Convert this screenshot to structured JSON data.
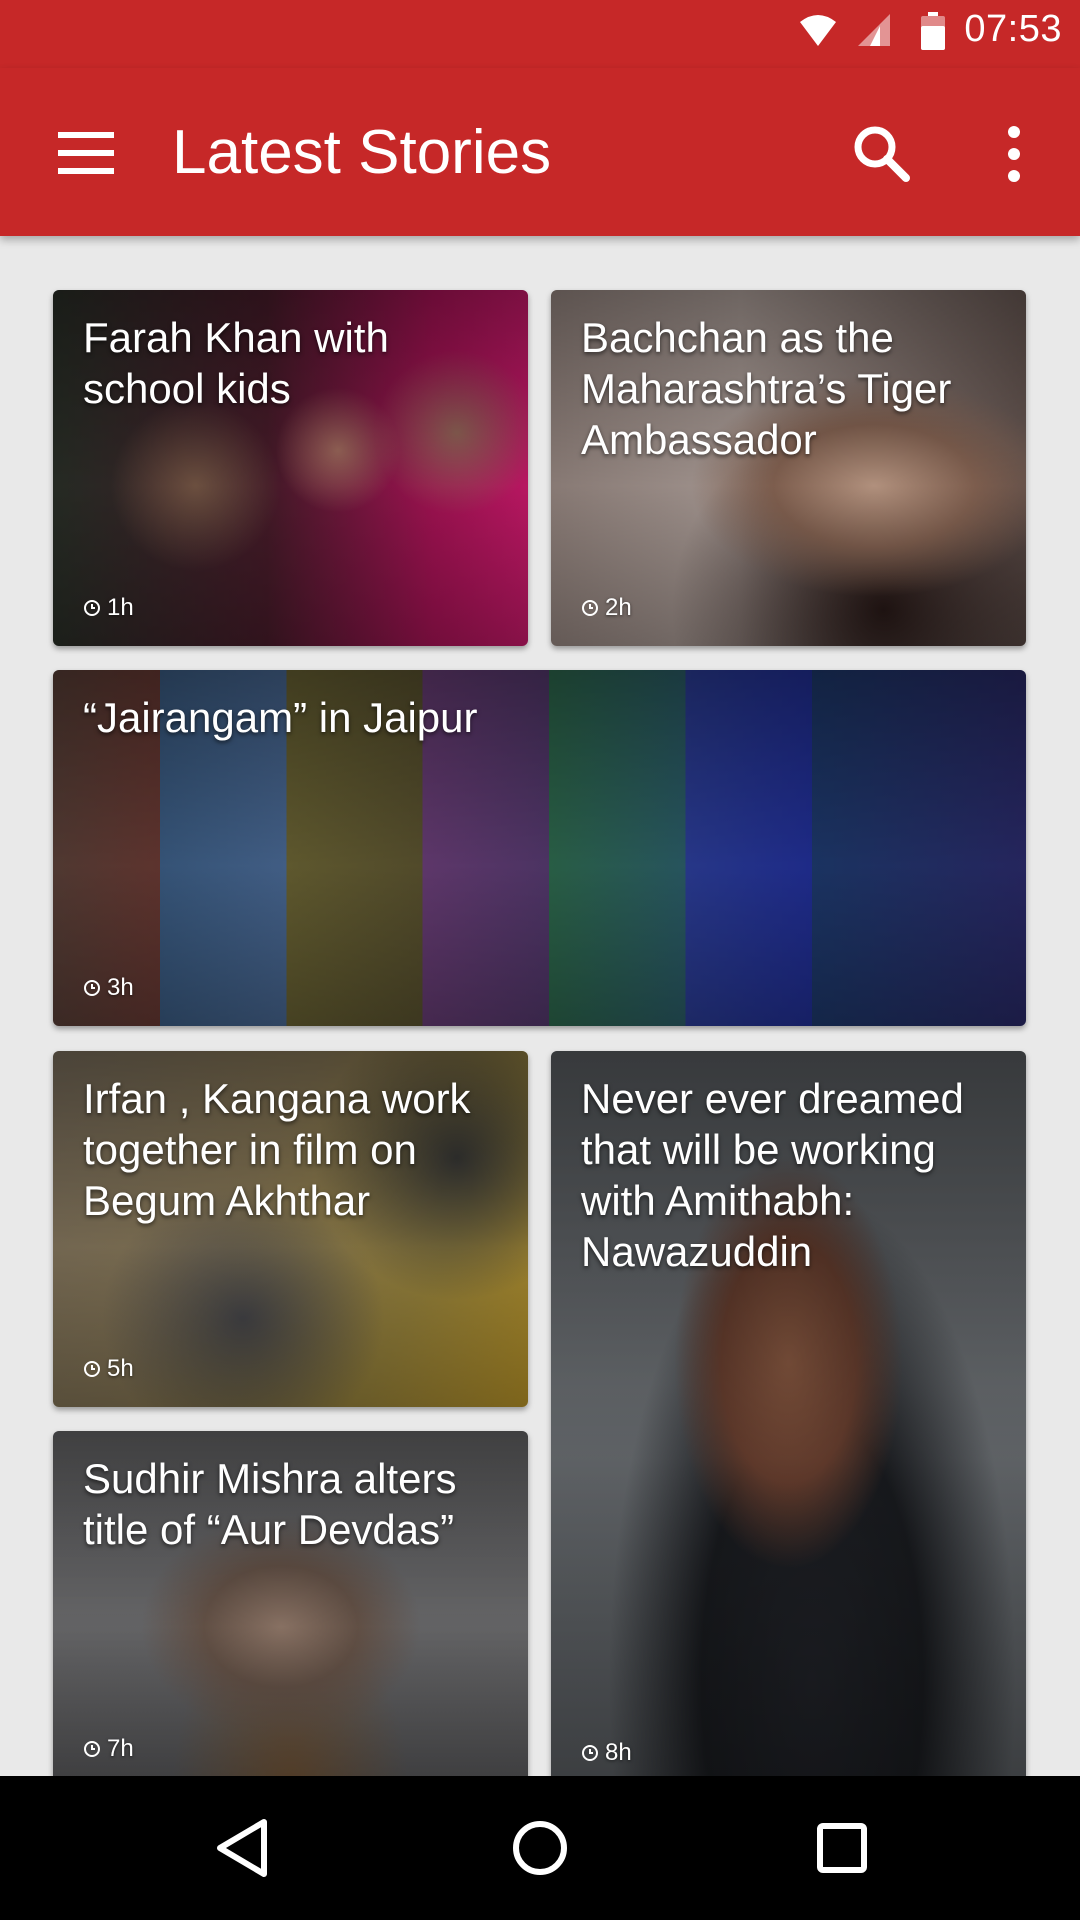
{
  "status_bar": {
    "time": "07:53",
    "icons": [
      "wifi-icon",
      "cell-signal-icon",
      "battery-icon"
    ],
    "color": "#c62828"
  },
  "app_bar": {
    "title": "Latest Stories",
    "color": "#c62828",
    "icons": [
      "menu-icon",
      "search-icon",
      "more-vert-icon"
    ]
  },
  "stories": [
    {
      "title": "Farah Khan with school kids",
      "time": "1h"
    },
    {
      "title": "Bachchan as the Maharashtra’s Tiger Ambassador",
      "time": "2h"
    },
    {
      "title": "“Jairangam” in Jaipur",
      "time": "3h"
    },
    {
      "title": "Irfan , Kangana work together in film on Begum Akhthar",
      "time": "5h"
    },
    {
      "title": "Never ever dreamed that will be working with Amithabh: Nawazuddin",
      "time": "8h"
    },
    {
      "title": "Sudhir Mishra alters title of  “Aur Devdas”",
      "time": "7h"
    }
  ],
  "nav_bar": {
    "buttons": [
      "back-icon",
      "home-icon",
      "recents-icon"
    ]
  }
}
